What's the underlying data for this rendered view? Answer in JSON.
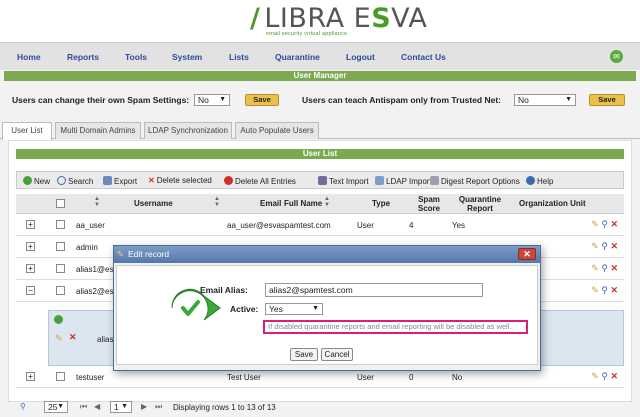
{
  "brand": {
    "name_part1": "LIBRA E",
    "name_s": "S",
    "name_part2": "VA",
    "tagline": "email security virtual appliance",
    "accent": "#4a9a2a"
  },
  "nav": [
    "Home",
    "Reports",
    "Tools",
    "System",
    "Lists",
    "Quarantine",
    "Logout",
    "Contact Us"
  ],
  "user_manager": {
    "title": "User Manager",
    "spam_settings_label": "Users can change their own Spam Settings:",
    "spam_settings_value": "No",
    "teach_label": "Users can teach Antispam only from Trusted Net:",
    "teach_value": "No",
    "save_label": "Save"
  },
  "tabs": [
    "User List",
    "Multi Domain Admins",
    "LDAP Synchronization",
    "Auto Populate Users"
  ],
  "user_list": {
    "title": "User List",
    "toolbar": [
      "New",
      "Search",
      "Export",
      "Delete selected",
      "Delete All Entries",
      "Text Import",
      "LDAP Import",
      "Digest Report Options",
      "Help"
    ],
    "columns": [
      "Username",
      "Email",
      "Full Name",
      "Type",
      "Spam Score",
      "Quarantine Report",
      "Organization Unit"
    ],
    "rows": [
      {
        "username": "aa_user",
        "email": "aa_user@esvaspamtest.com",
        "fullname": "",
        "type": "User",
        "score": "4",
        "report": "Yes"
      },
      {
        "username": "admin",
        "email": "",
        "fullname": "",
        "type": "",
        "score": "",
        "report": ""
      },
      {
        "username": "alias1@es",
        "email": "",
        "fullname": "",
        "type": "",
        "score": "",
        "report": ""
      },
      {
        "username": "alias2@es",
        "email": "",
        "fullname": "",
        "type": "",
        "score": "",
        "report": ""
      },
      {
        "username": "testuser",
        "email": "",
        "fullname": "Test User",
        "type": "User",
        "score": "0",
        "report": "No"
      }
    ],
    "subrow_text": "alias"
  },
  "pager": {
    "page_size": "25",
    "page": "1",
    "status": "Displaying rows 1 to 13 of 13"
  },
  "modal": {
    "title": "Edit record",
    "email_label": "Email Alias:",
    "email_value": "alias2@spamtest.com",
    "active_label": "Active:",
    "active_value": "Yes",
    "hint": "If disabled quarantine reports and email reporting will be disabled as well.",
    "save": "Save",
    "cancel": "Cancel",
    "highlight_color": "#d8207a"
  }
}
